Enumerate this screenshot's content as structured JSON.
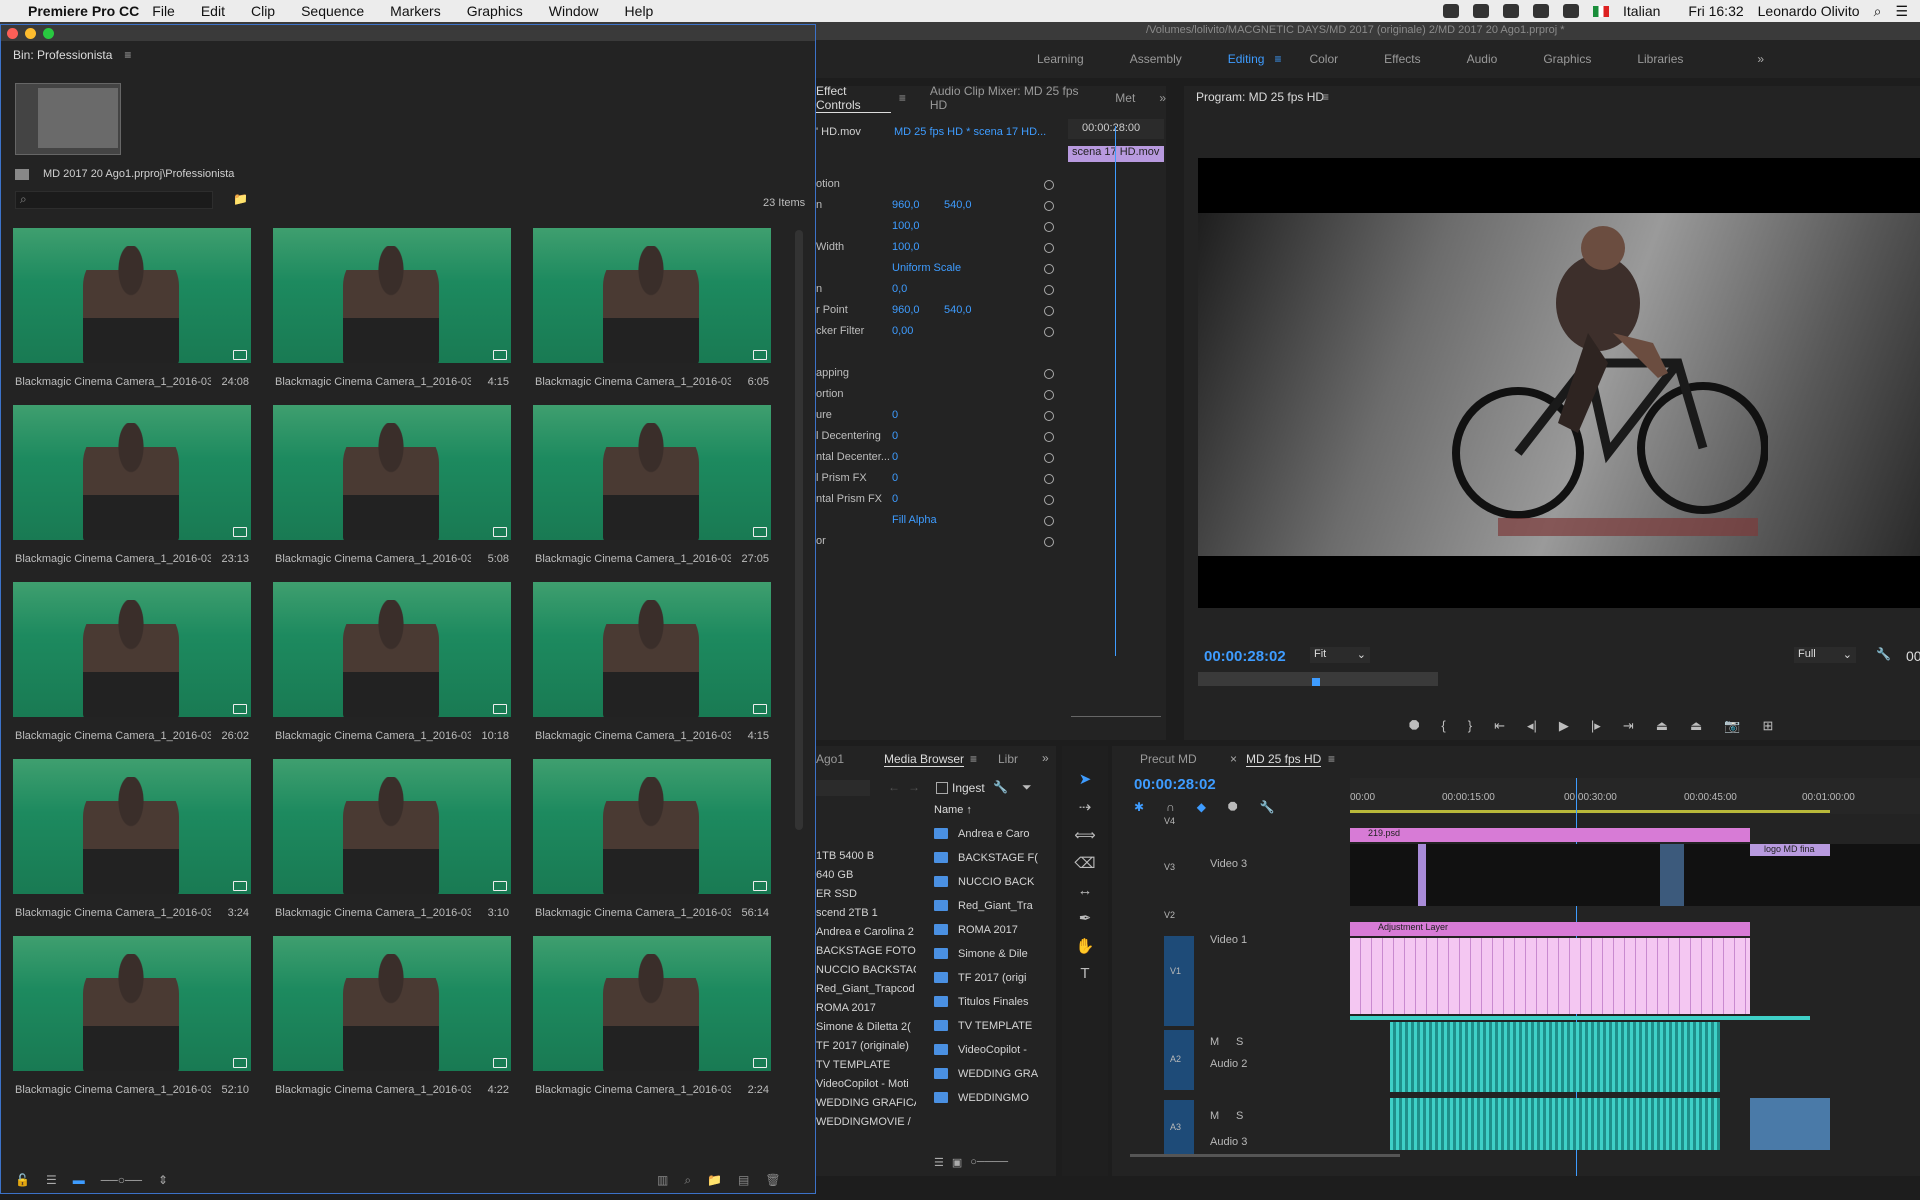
{
  "menubar": {
    "app": "Premiere Pro CC",
    "items": [
      "File",
      "Edit",
      "Clip",
      "Sequence",
      "Markers",
      "Graphics",
      "Window",
      "Help"
    ],
    "language": "Italian",
    "clock": "Fri 16:32",
    "user": "Leonardo Olivito"
  },
  "header": {
    "path": "/Volumes/lolivito/MACGNETIC DAYS/MD 2017 (originale) 2/MD 2017  20 Ago1.prproj *"
  },
  "workspaces": [
    "Learning",
    "Assembly",
    "Editing",
    "Color",
    "Effects",
    "Audio",
    "Graphics",
    "Libraries"
  ],
  "workspace_active": "Editing",
  "bin": {
    "title": "Bin: Professionista",
    "path": "MD 2017  20 Ago1.prproj\\Professionista",
    "search_placeholder": "",
    "count": "23 Items",
    "clips": [
      {
        "name": "Blackmagic Cinema Camera_1_2016-03-...",
        "dur": "24:08"
      },
      {
        "name": "Blackmagic Cinema Camera_1_2016-03-1...",
        "dur": "4:15"
      },
      {
        "name": "Blackmagic Cinema Camera_1_2016-03-1...",
        "dur": "6:05"
      },
      {
        "name": "Blackmagic Cinema Camera_1_2016-03-...",
        "dur": "23:13"
      },
      {
        "name": "Blackmagic Cinema Camera_1_2016-03-1...",
        "dur": "5:08"
      },
      {
        "name": "Blackmagic Cinema Camera_1_2016-03-...",
        "dur": "27:05"
      },
      {
        "name": "Blackmagic Cinema Camera_1_2016-03-...",
        "dur": "26:02"
      },
      {
        "name": "Blackmagic Cinema Camera_1_2016-03-...",
        "dur": "10:18"
      },
      {
        "name": "Blackmagic Cinema Camera_1_2016-03-1...",
        "dur": "4:15"
      },
      {
        "name": "Blackmagic Cinema Camera_1_2016-03-1...",
        "dur": "3:24"
      },
      {
        "name": "Blackmagic Cinema Camera_1_2016-03-1...",
        "dur": "3:10"
      },
      {
        "name": "Blackmagic Cinema Camera_1_2016-03-...",
        "dur": "56:14"
      },
      {
        "name": "Blackmagic Cinema Camera_1_2016-03-...",
        "dur": "52:10"
      },
      {
        "name": "Blackmagic Cinema Camera_1_2016-03-1...",
        "dur": "4:22"
      },
      {
        "name": "Blackmagic Cinema Camera_1_2016-03-1...",
        "dur": "2:24"
      }
    ]
  },
  "effect_controls": {
    "tabs": [
      "Effect Controls",
      "Audio Clip Mixer: MD 25 fps HD",
      "Met"
    ],
    "source": "' HD.mov",
    "sequence": "MD 25 fps HD * scena 17 HD...",
    "timecode": "00:00:28:00",
    "clip_label": "scena 17 HD.mov",
    "rows": [
      {
        "label": "otion",
        "v1": "",
        "v2": ""
      },
      {
        "label": "n",
        "v1": "960,0",
        "v2": "540,0"
      },
      {
        "label": "",
        "v1": "100,0",
        "v2": ""
      },
      {
        "label": "Width",
        "v1": "100,0",
        "v2": ""
      },
      {
        "label": "",
        "v1": "Uniform Scale",
        "v2": ""
      },
      {
        "label": "n",
        "v1": "0,0",
        "v2": ""
      },
      {
        "label": "r Point",
        "v1": "960,0",
        "v2": "540,0"
      },
      {
        "label": "cker Filter",
        "v1": "0,00",
        "v2": ""
      },
      {
        "label": "apping",
        "v1": "",
        "v2": ""
      },
      {
        "label": "ortion",
        "v1": "",
        "v2": ""
      },
      {
        "label": "ure",
        "v1": "0",
        "v2": ""
      },
      {
        "label": "l Decentering",
        "v1": "0",
        "v2": ""
      },
      {
        "label": "ntal Decenter...",
        "v1": "0",
        "v2": ""
      },
      {
        "label": "l Prism FX",
        "v1": "0",
        "v2": ""
      },
      {
        "label": "ntal Prism FX",
        "v1": "0",
        "v2": ""
      },
      {
        "label": "",
        "v1": "Fill Alpha",
        "v2": ""
      },
      {
        "label": "or",
        "v1": "",
        "v2": ""
      }
    ]
  },
  "program": {
    "title": "Program: MD 25 fps HD",
    "timecode": "00:00:28:02",
    "fit": "Fit",
    "quality": "Full",
    "right_tc": "00"
  },
  "media_browser": {
    "tabs": [
      "Ago1",
      "Media Browser",
      "Libr"
    ],
    "ingest": "Ingest",
    "name_header": "Name",
    "drives": [
      "1TB 5400 B",
      "640 GB",
      "ER SSD",
      "scend 2TB 1",
      "Andrea e Carolina 2",
      "BACKSTAGE FOTO /",
      "NUCCIO BACKSTAG",
      "Red_Giant_Trapcod",
      "ROMA 2017",
      "Simone & Diletta 2(",
      "TF 2017 (originale)",
      "TV TEMPLATE",
      "VideoCopilot - Moti",
      "WEDDING GRAFICA",
      "WEDDINGMOVIE /"
    ],
    "files": [
      "Andrea e Caro",
      "BACKSTAGE F(",
      "NUCCIO BACK",
      "Red_Giant_Tra",
      "ROMA 2017",
      "Simone & Dile",
      "TF 2017 (origi",
      "Titulos Finales",
      "TV TEMPLATE",
      "VideoCopilot -",
      "WEDDING GRA",
      "WEDDINGMO"
    ]
  },
  "timeline": {
    "tabs": [
      "Precut MD",
      "MD 25 fps HD"
    ],
    "timecode": "00:00:28:02",
    "ruler": [
      "00:00",
      "00:00:15:00",
      "00:00:30:00",
      "00:00:45:00",
      "00:01:00:00"
    ],
    "tracks": {
      "v4": "V4",
      "v3": "V3",
      "v3_name": "Video 3",
      "v2": "V2",
      "v1": "V1",
      "v1_name": "Video 1",
      "a2": "A2",
      "a2_name": "Audio 2",
      "a3": "A3",
      "a3_name": "Audio 3"
    },
    "clips": {
      "psd": "219.psd",
      "adj": "Adjustment Layer",
      "logo": "logo MD fina"
    },
    "mute": "M",
    "solo": "S"
  },
  "colors": {
    "accent": "#3e9cff",
    "pink": "#d77bd6",
    "teal": "#3fd0c7"
  }
}
